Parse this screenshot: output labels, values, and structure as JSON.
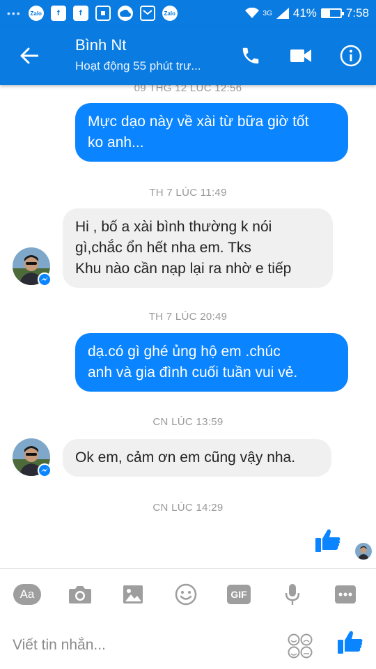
{
  "status_bar": {
    "network": "3G",
    "battery_percent": "41%",
    "battery_level": 0.41,
    "time": "7:58",
    "notification_icons": [
      "zalo-icon",
      "facebook-icon",
      "facebook-icon",
      "scan-icon",
      "cloud-icon",
      "gmail-icon",
      "zalo-icon"
    ],
    "zalo_label": "Zalo"
  },
  "header": {
    "contact_name": "Bình Nt",
    "status": "Hoạt động 55 phút trư..."
  },
  "timestamps": {
    "t0": "09 THG 12 LÚC 12:56",
    "t1": "TH 7 LÚC 11:49",
    "t2": "TH 7 LÚC 20:49",
    "t3": "CN LÚC 13:59",
    "t4": "CN LÚC 14:29"
  },
  "messages": [
    {
      "direction": "out",
      "lines": [
        "Mực dạo này về xài từ bữa giờ tốt",
        "ko anh..."
      ]
    },
    {
      "direction": "in",
      "lines": [
        "Hi , bố a xài bình thường k nói",
        "gì,chắc ổn hết nha em. Tks",
        "Khu nào cần nạp lại ra nhờ e tiếp"
      ]
    },
    {
      "direction": "out",
      "lines": [
        "dạ.có gì ghé ủng hộ em .chúc",
        "anh và gia đình cuối tuần vui vẻ."
      ]
    },
    {
      "direction": "in",
      "lines": [
        "Ok em, cảm ơn em cũng vậy nha."
      ]
    }
  ],
  "composer": {
    "aa_label": "Aa",
    "gif_label": "GIF",
    "placeholder": "Viết tin nhắn..."
  },
  "colors": {
    "brand": "#0a7be0",
    "outgoing_bubble": "#0a84ff",
    "incoming_bubble": "#f0f0f0",
    "timestamp": "#999999",
    "icon_gray": "#9e9e9e"
  }
}
